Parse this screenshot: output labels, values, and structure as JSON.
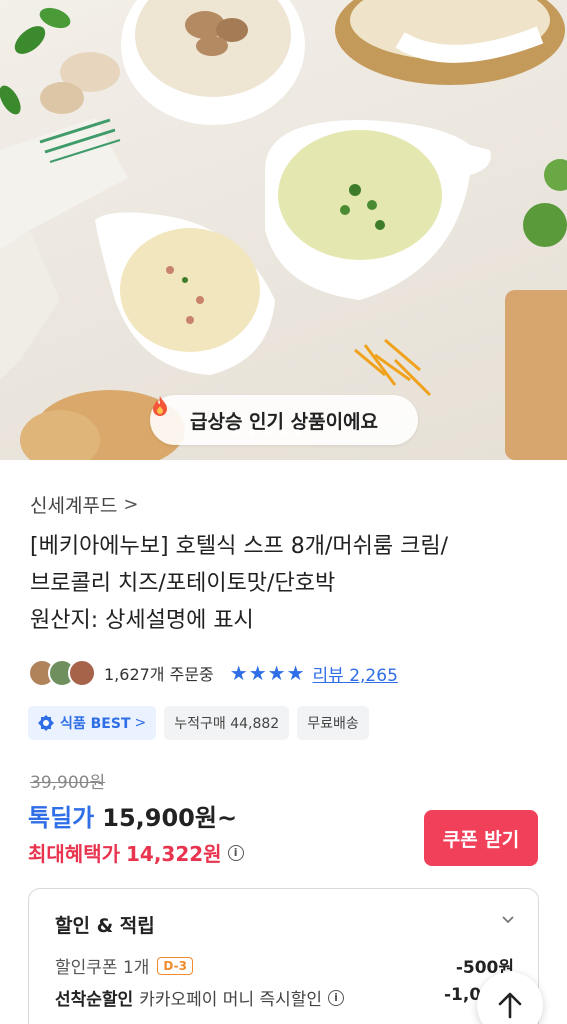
{
  "hero": {
    "badge_text": "급상승 인기 상품이에요",
    "fire_icon": "fire-icon",
    "carousel": {
      "count": 5,
      "active": 1
    }
  },
  "product": {
    "brand": "신세계푸드",
    "brand_chevron": ">",
    "title_lines": [
      "[베키아에누보] 호텔식 스프 8개/머쉬룸 크림/",
      "브로콜리 치즈/포테이토맛/단호박",
      "원산지: 상세설명에 표시"
    ],
    "orders": "1,627개 주문중",
    "rating_stars": 4,
    "review_label": "리뷰 2,265",
    "tags": {
      "best": "식품 BEST",
      "best_chevron": ">",
      "cumulative": "누적구매 44,882",
      "shipping": "무료배송"
    }
  },
  "price": {
    "original": "39,900원",
    "deal_label": "톡딜가",
    "deal_price": "15,900원~",
    "max_label": "최대혜택가",
    "max_price": "14,322원",
    "info_glyph": "i",
    "coupon_button": "쿠폰 받기"
  },
  "discount": {
    "heading": "할인 & 적립",
    "coupon_row": {
      "label": "할인쿠폰 1개",
      "dday": "D-3",
      "amount": "-500원"
    },
    "first_come_row": {
      "bold": "선착순할인",
      "label": "카카오페이 머니 즉시할인",
      "info_glyph": "i",
      "amount": "-1,0"
    }
  },
  "colors": {
    "accent_blue": "#2f6ee6",
    "accent_red": "#f0405a",
    "dday_orange": "#f18b2c"
  }
}
